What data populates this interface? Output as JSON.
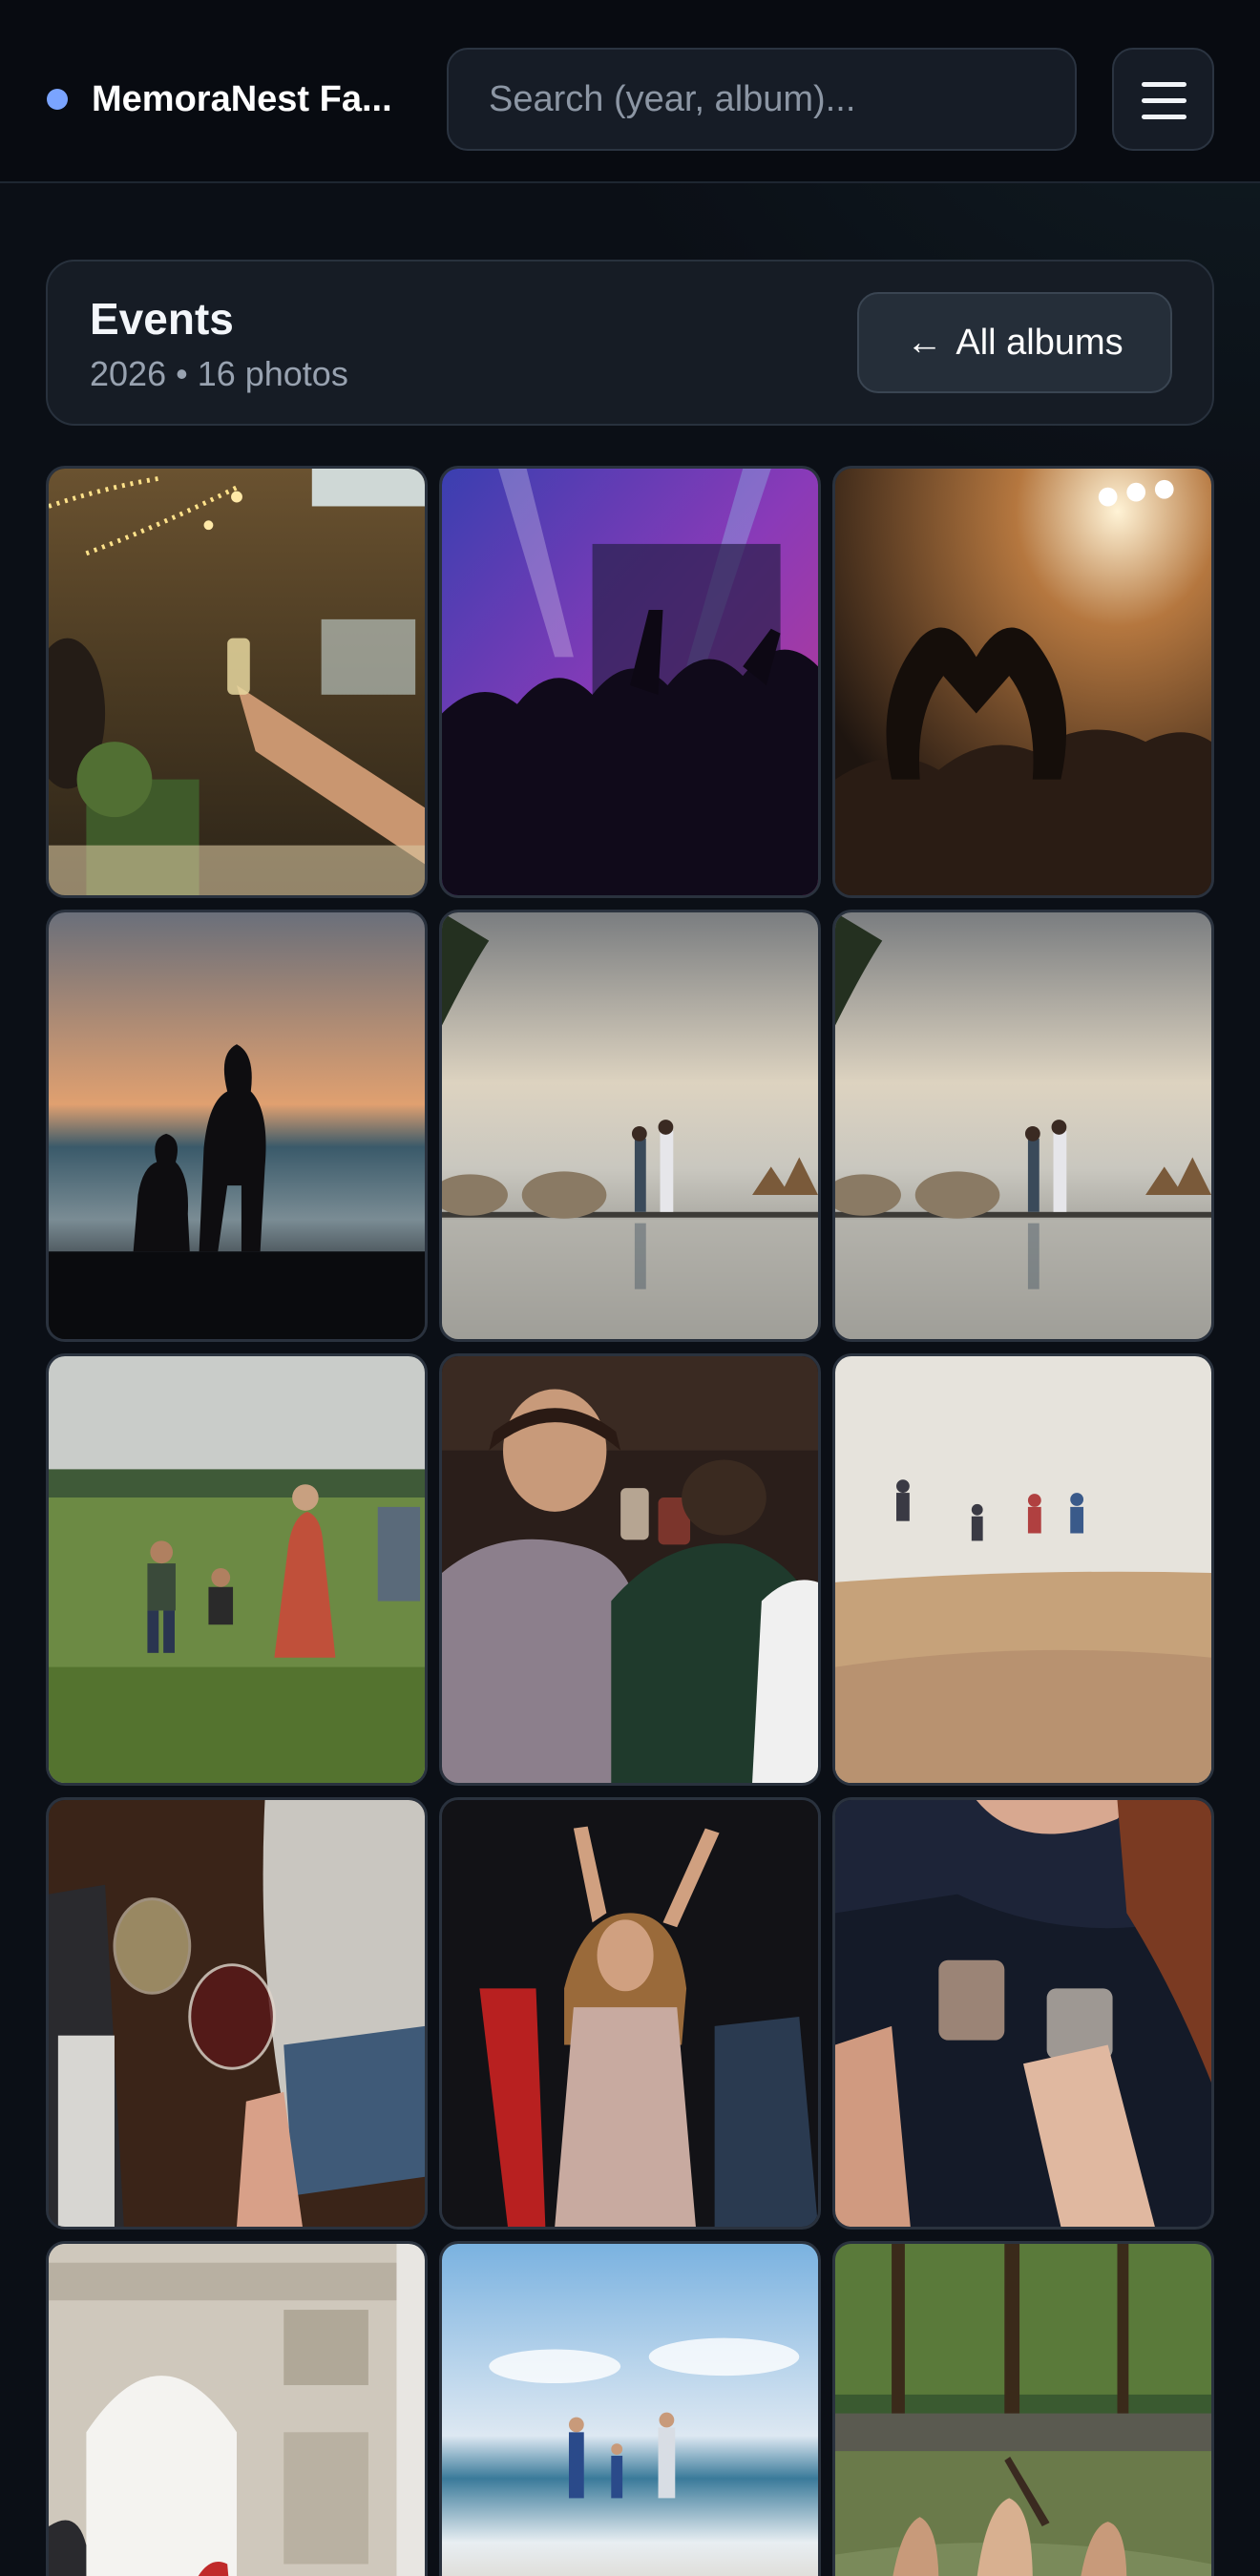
{
  "header": {
    "brand_name": "MemoraNest Fa...",
    "search_placeholder": "Search (year, album)...",
    "menu_icon": "hamburger-menu-icon"
  },
  "album": {
    "title": "Events",
    "meta": "2026 • 16 photos",
    "back_label": "All albums",
    "back_icon": "arrow-left-icon"
  },
  "photos": [
    {
      "id": "p1",
      "scene": "wedding-toast"
    },
    {
      "id": "p2",
      "scene": "concert-crowd-purple"
    },
    {
      "id": "p3",
      "scene": "concert-heart-hands"
    },
    {
      "id": "p4",
      "scene": "sunset-silhouette-family"
    },
    {
      "id": "p5",
      "scene": "resort-pier-couple"
    },
    {
      "id": "p6",
      "scene": "resort-pier-couple"
    },
    {
      "id": "p7",
      "scene": "family-meadow"
    },
    {
      "id": "p8",
      "scene": "party-cheers"
    },
    {
      "id": "p9",
      "scene": "desert-jump"
    },
    {
      "id": "p10",
      "scene": "wine-glasses"
    },
    {
      "id": "p11",
      "scene": "party-dancing"
    },
    {
      "id": "p12",
      "scene": "drinks-closeup"
    },
    {
      "id": "p13",
      "scene": "arc-de-triomphe"
    },
    {
      "id": "p14",
      "scene": "beach-family"
    },
    {
      "id": "p15",
      "scene": "forest-paddleboard"
    }
  ],
  "colors": {
    "background": "#0b0f16",
    "brand_dot": "#7aa4ff",
    "card": "#161c25"
  }
}
